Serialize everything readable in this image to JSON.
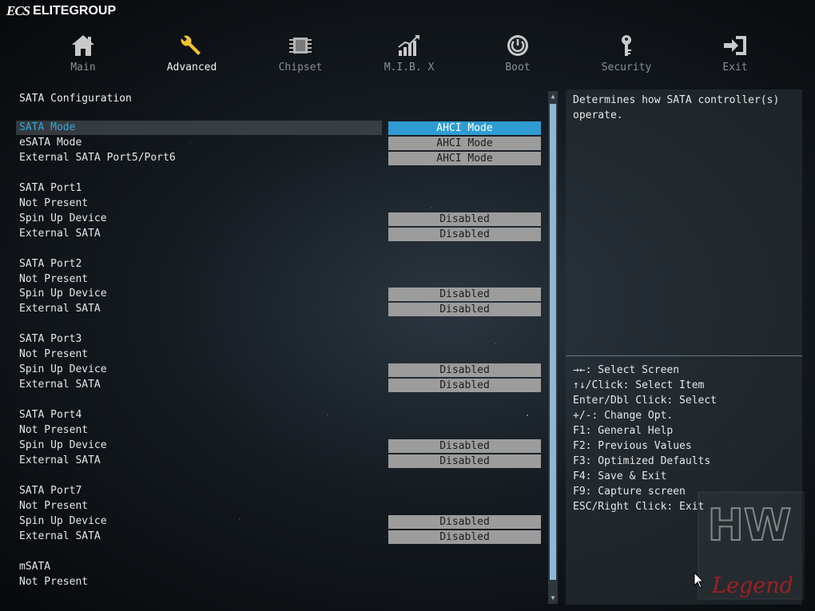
{
  "brand": {
    "logo": "ECS",
    "name": "ELITEGROUP"
  },
  "nav": [
    {
      "label": "Main",
      "icon": "home-icon"
    },
    {
      "label": "Advanced",
      "icon": "wrench-icon",
      "active": true
    },
    {
      "label": "Chipset",
      "icon": "chip-icon"
    },
    {
      "label": "M.I.B. X",
      "icon": "chart-icon"
    },
    {
      "label": "Boot",
      "icon": "power-icon"
    },
    {
      "label": "Security",
      "icon": "key-icon"
    },
    {
      "label": "Exit",
      "icon": "exit-icon"
    }
  ],
  "section_title": "SATA Configuration",
  "rows": [
    {
      "label": "SATA Mode",
      "value": "AHCI Mode",
      "selected": true
    },
    {
      "label": "eSATA Mode",
      "value": "AHCI Mode"
    },
    {
      "label": "External SATA Port5/Port6",
      "value": "AHCI Mode"
    },
    {
      "label": "SATA Port1"
    },
    {
      "label": "Not Present"
    },
    {
      "label": "Spin Up Device",
      "value": "Disabled"
    },
    {
      "label": "External SATA",
      "value": "Disabled"
    },
    {
      "label": "SATA Port2"
    },
    {
      "label": "Not Present"
    },
    {
      "label": "Spin Up Device",
      "value": "Disabled"
    },
    {
      "label": "External SATA",
      "value": "Disabled"
    },
    {
      "label": "SATA Port3"
    },
    {
      "label": "Not Present"
    },
    {
      "label": "Spin Up Device",
      "value": "Disabled"
    },
    {
      "label": "External SATA",
      "value": "Disabled"
    },
    {
      "label": "SATA Port4"
    },
    {
      "label": "Not Present"
    },
    {
      "label": "Spin Up Device",
      "value": "Disabled"
    },
    {
      "label": "External SATA",
      "value": "Disabled"
    },
    {
      "label": "SATA Port7"
    },
    {
      "label": "Not Present"
    },
    {
      "label": "Spin Up Device",
      "value": "Disabled"
    },
    {
      "label": "External SATA",
      "value": "Disabled"
    },
    {
      "label": "mSATA"
    },
    {
      "label": "Not Present"
    }
  ],
  "help": "Determines how SATA controller(s) operate.",
  "keys": [
    "→←: Select Screen",
    "↑↓/Click: Select Item",
    "Enter/Dbl Click: Select",
    "+/-: Change Opt.",
    "F1: General Help",
    "F2: Previous Values",
    "F3: Optimized Defaults",
    "F4: Save & Exit",
    "F9: Capture screen",
    "ESC/Right Click: Exit"
  ],
  "watermark": {
    "top": "HW",
    "bottom": "Legend"
  },
  "colors": {
    "accent": "#2e9cd2",
    "selected_text": "#35a7d8",
    "value_bg": "#9c9c9c"
  }
}
